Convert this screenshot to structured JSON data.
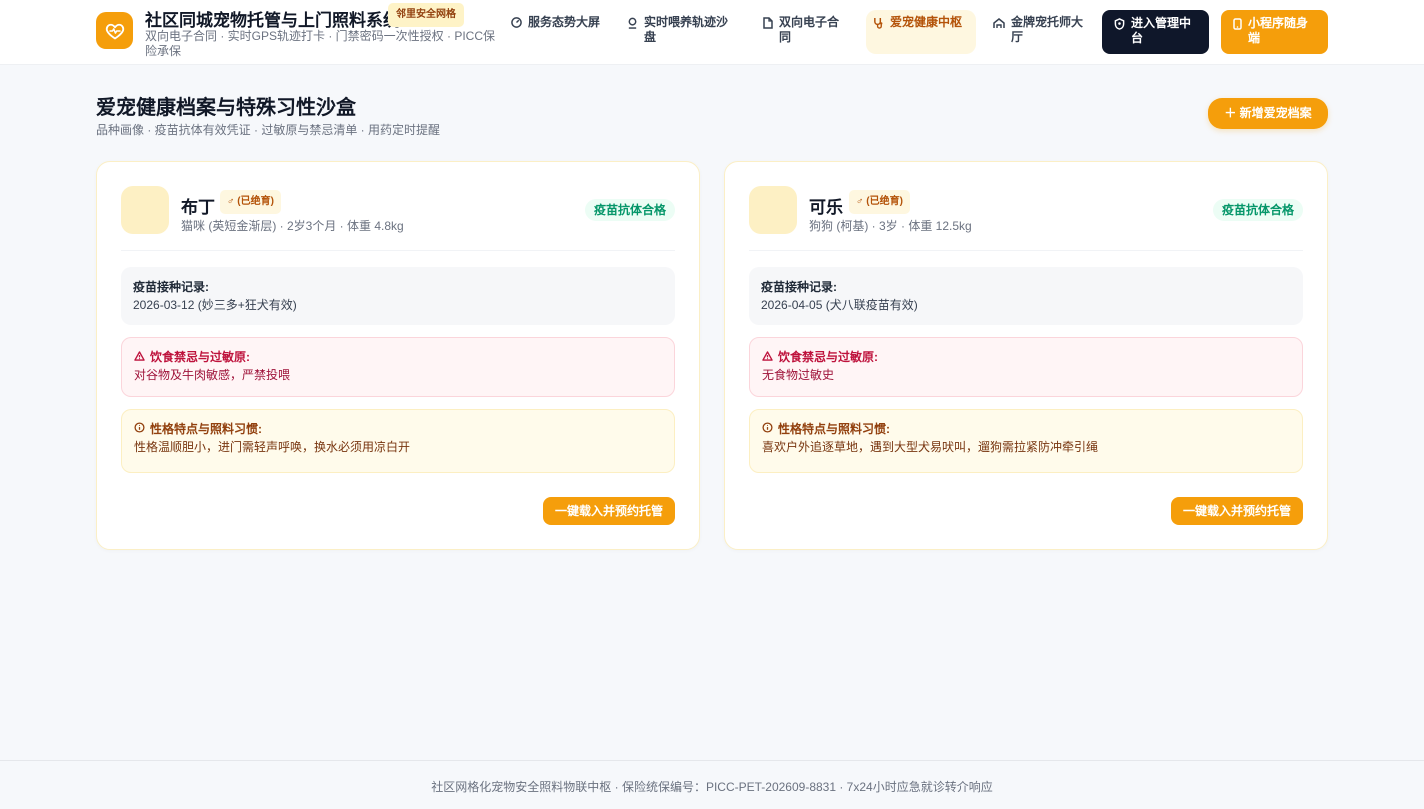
{
  "header": {
    "brand_title": "社区同城宠物托管与上门照料系统",
    "brand_badge": "邻里安全网格",
    "brand_subtitle": "双向电子合同 · 实时GPS轨迹打卡 · 门禁密码一次性授权 · PICC保险承保",
    "nav": [
      {
        "label": "服务态势大屏",
        "icon": "dashboard-icon"
      },
      {
        "label": "实时喂养轨迹沙盘",
        "icon": "map-pin-icon"
      },
      {
        "label": "双向电子合同",
        "icon": "document-icon"
      },
      {
        "label": "爱宠健康中枢",
        "icon": "stethoscope-icon",
        "active": true
      },
      {
        "label": "金牌宠托师大厅",
        "icon": "people-icon"
      }
    ],
    "admin_label": "进入管理中台",
    "mini_label": "小程序随身端"
  },
  "page": {
    "title": "爱宠健康档案与特殊习性沙盒",
    "subtitle": "品种画像 · 疫苗抗体有效凭证 · 过敏原与禁忌清单 · 用药定时提醒",
    "add_button": "＋ 新增爱宠档案"
  },
  "pets": [
    {
      "name": "布丁",
      "neuter": "♂ (已绝育)",
      "meta": "猫咪 (英短金渐层) · 2岁3个月 · 体重 4.8kg",
      "vax_status": "疫苗抗体合格",
      "vax_title": "疫苗接种记录:",
      "vax_detail": "2026-03-12 (妙三多+狂犬有效)",
      "allergy_title": "饮食禁忌与过敏原:",
      "allergy_detail": "对谷物及牛肉敏感，严禁投喂",
      "temper_title": "性格特点与照料习惯:",
      "temper_detail": "性格温顺胆小，进门需轻声呼唤，换水必须用凉白开",
      "book_button": "一键载入并预约托管"
    },
    {
      "name": "可乐",
      "neuter": "♂ (已绝育)",
      "meta": "狗狗 (柯基) · 3岁 · 体重 12.5kg",
      "vax_status": "疫苗抗体合格",
      "vax_title": "疫苗接种记录:",
      "vax_detail": "2026-04-05 (犬八联疫苗有效)",
      "allergy_title": "饮食禁忌与过敏原:",
      "allergy_detail": "无食物过敏史",
      "temper_title": "性格特点与照料习惯:",
      "temper_detail": "喜欢户外追逐草地，遇到大型犬易吠叫，遛狗需拉紧防冲牵引绳",
      "book_button": "一键载入并预约托管"
    }
  ],
  "footer": {
    "text": "社区网格化宠物安全照料物联中枢 · 保险统保编号：PICC-PET-202609-8831 · 7x24小时应急就诊转介响应"
  },
  "colors": {
    "accent": "#f59e0b",
    "dark": "#0f172a",
    "success": "#059669",
    "danger": "#be123c"
  }
}
